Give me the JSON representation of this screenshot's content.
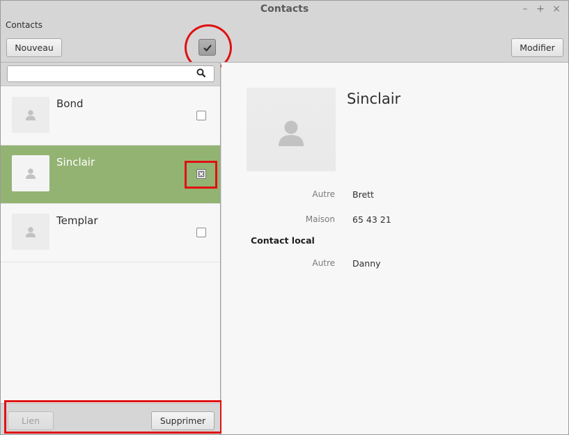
{
  "window": {
    "title": "Contacts"
  },
  "menu": {
    "app_label": "Contacts"
  },
  "toolbar": {
    "new_label": "Nouveau",
    "edit_label": "Modifier",
    "select_toggle_icon": "checkmark-icon"
  },
  "search": {
    "value": "",
    "placeholder": ""
  },
  "contacts": [
    {
      "name": "Bond",
      "selected": false
    },
    {
      "name": "Sinclair",
      "selected": true
    },
    {
      "name": "Templar",
      "selected": false
    }
  ],
  "actions": {
    "link_label": "Lien",
    "delete_label": "Supprimer"
  },
  "detail": {
    "name": "Sinclair",
    "fields": [
      {
        "label": "Autre",
        "value": "Brett"
      },
      {
        "label": "Maison",
        "value": "65 43 21"
      }
    ],
    "section_title": "Contact local",
    "section_fields": [
      {
        "label": "Autre",
        "value": "Danny"
      }
    ]
  },
  "colors": {
    "selected_row": "#93b373",
    "annotation": "#e01111"
  }
}
